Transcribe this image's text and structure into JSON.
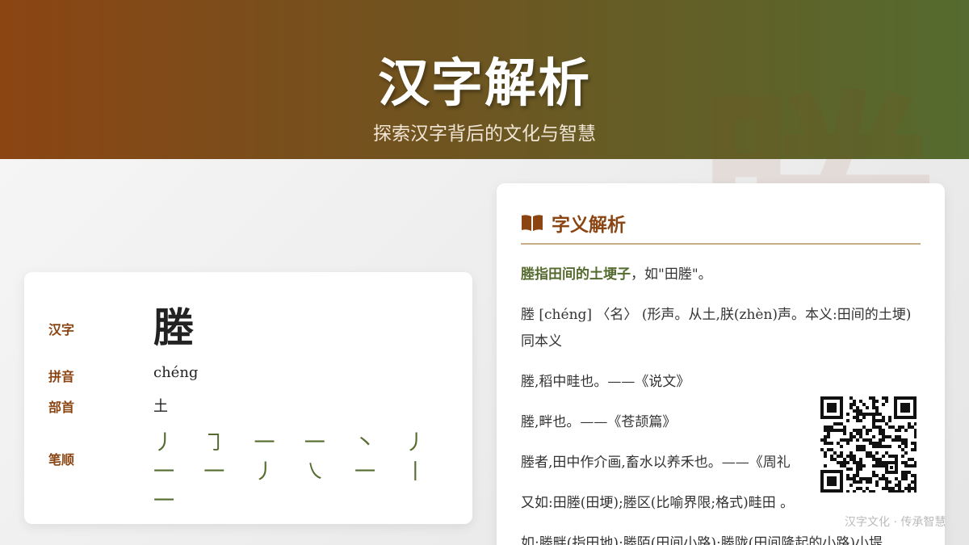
{
  "header": {
    "title": "汉字解析",
    "subtitle": "探索汉字背后的文化与智慧"
  },
  "watermark_char": "塍",
  "info": {
    "char_label": "汉字",
    "char": "塍",
    "pinyin_label": "拼音",
    "pinyin": "chéng",
    "radical_label": "部首",
    "radical": "土",
    "strokes_label": "笔顺",
    "strokes": "丿 ㇆ 一 一 丶 丿 一 一 丿 ㇏ 一 丨 一"
  },
  "definition": {
    "icon": "book-icon",
    "title": "字义解析",
    "summary_highlight": "塍指田间的土埂子",
    "summary_rest": "，如\"田塍\"。",
    "paragraphs": [
      "塍 [chéng] 〈名〉 (形声。从土,朕(zhèn)声。本义:田间的土埂) 同本义",
      "塍,稻中畦也。——《说文》",
      "塍,畔也。——《苍颉篇》",
      "塍者,田中作介画,畜水以养禾也。——《周礼",
      "又如:田塍(田埂);塍区(比喻界限;格式)畦田 。",
      "如:塍畔(指田地);塍陌(田间小路);塍陇(田间隆起的小路)小堤"
    ]
  },
  "qr_icon": "qr-code-icon",
  "footer": "汉字文化 · 传承智慧",
  "colors": {
    "brown": "#8b4513",
    "olive": "#556b2f"
  }
}
